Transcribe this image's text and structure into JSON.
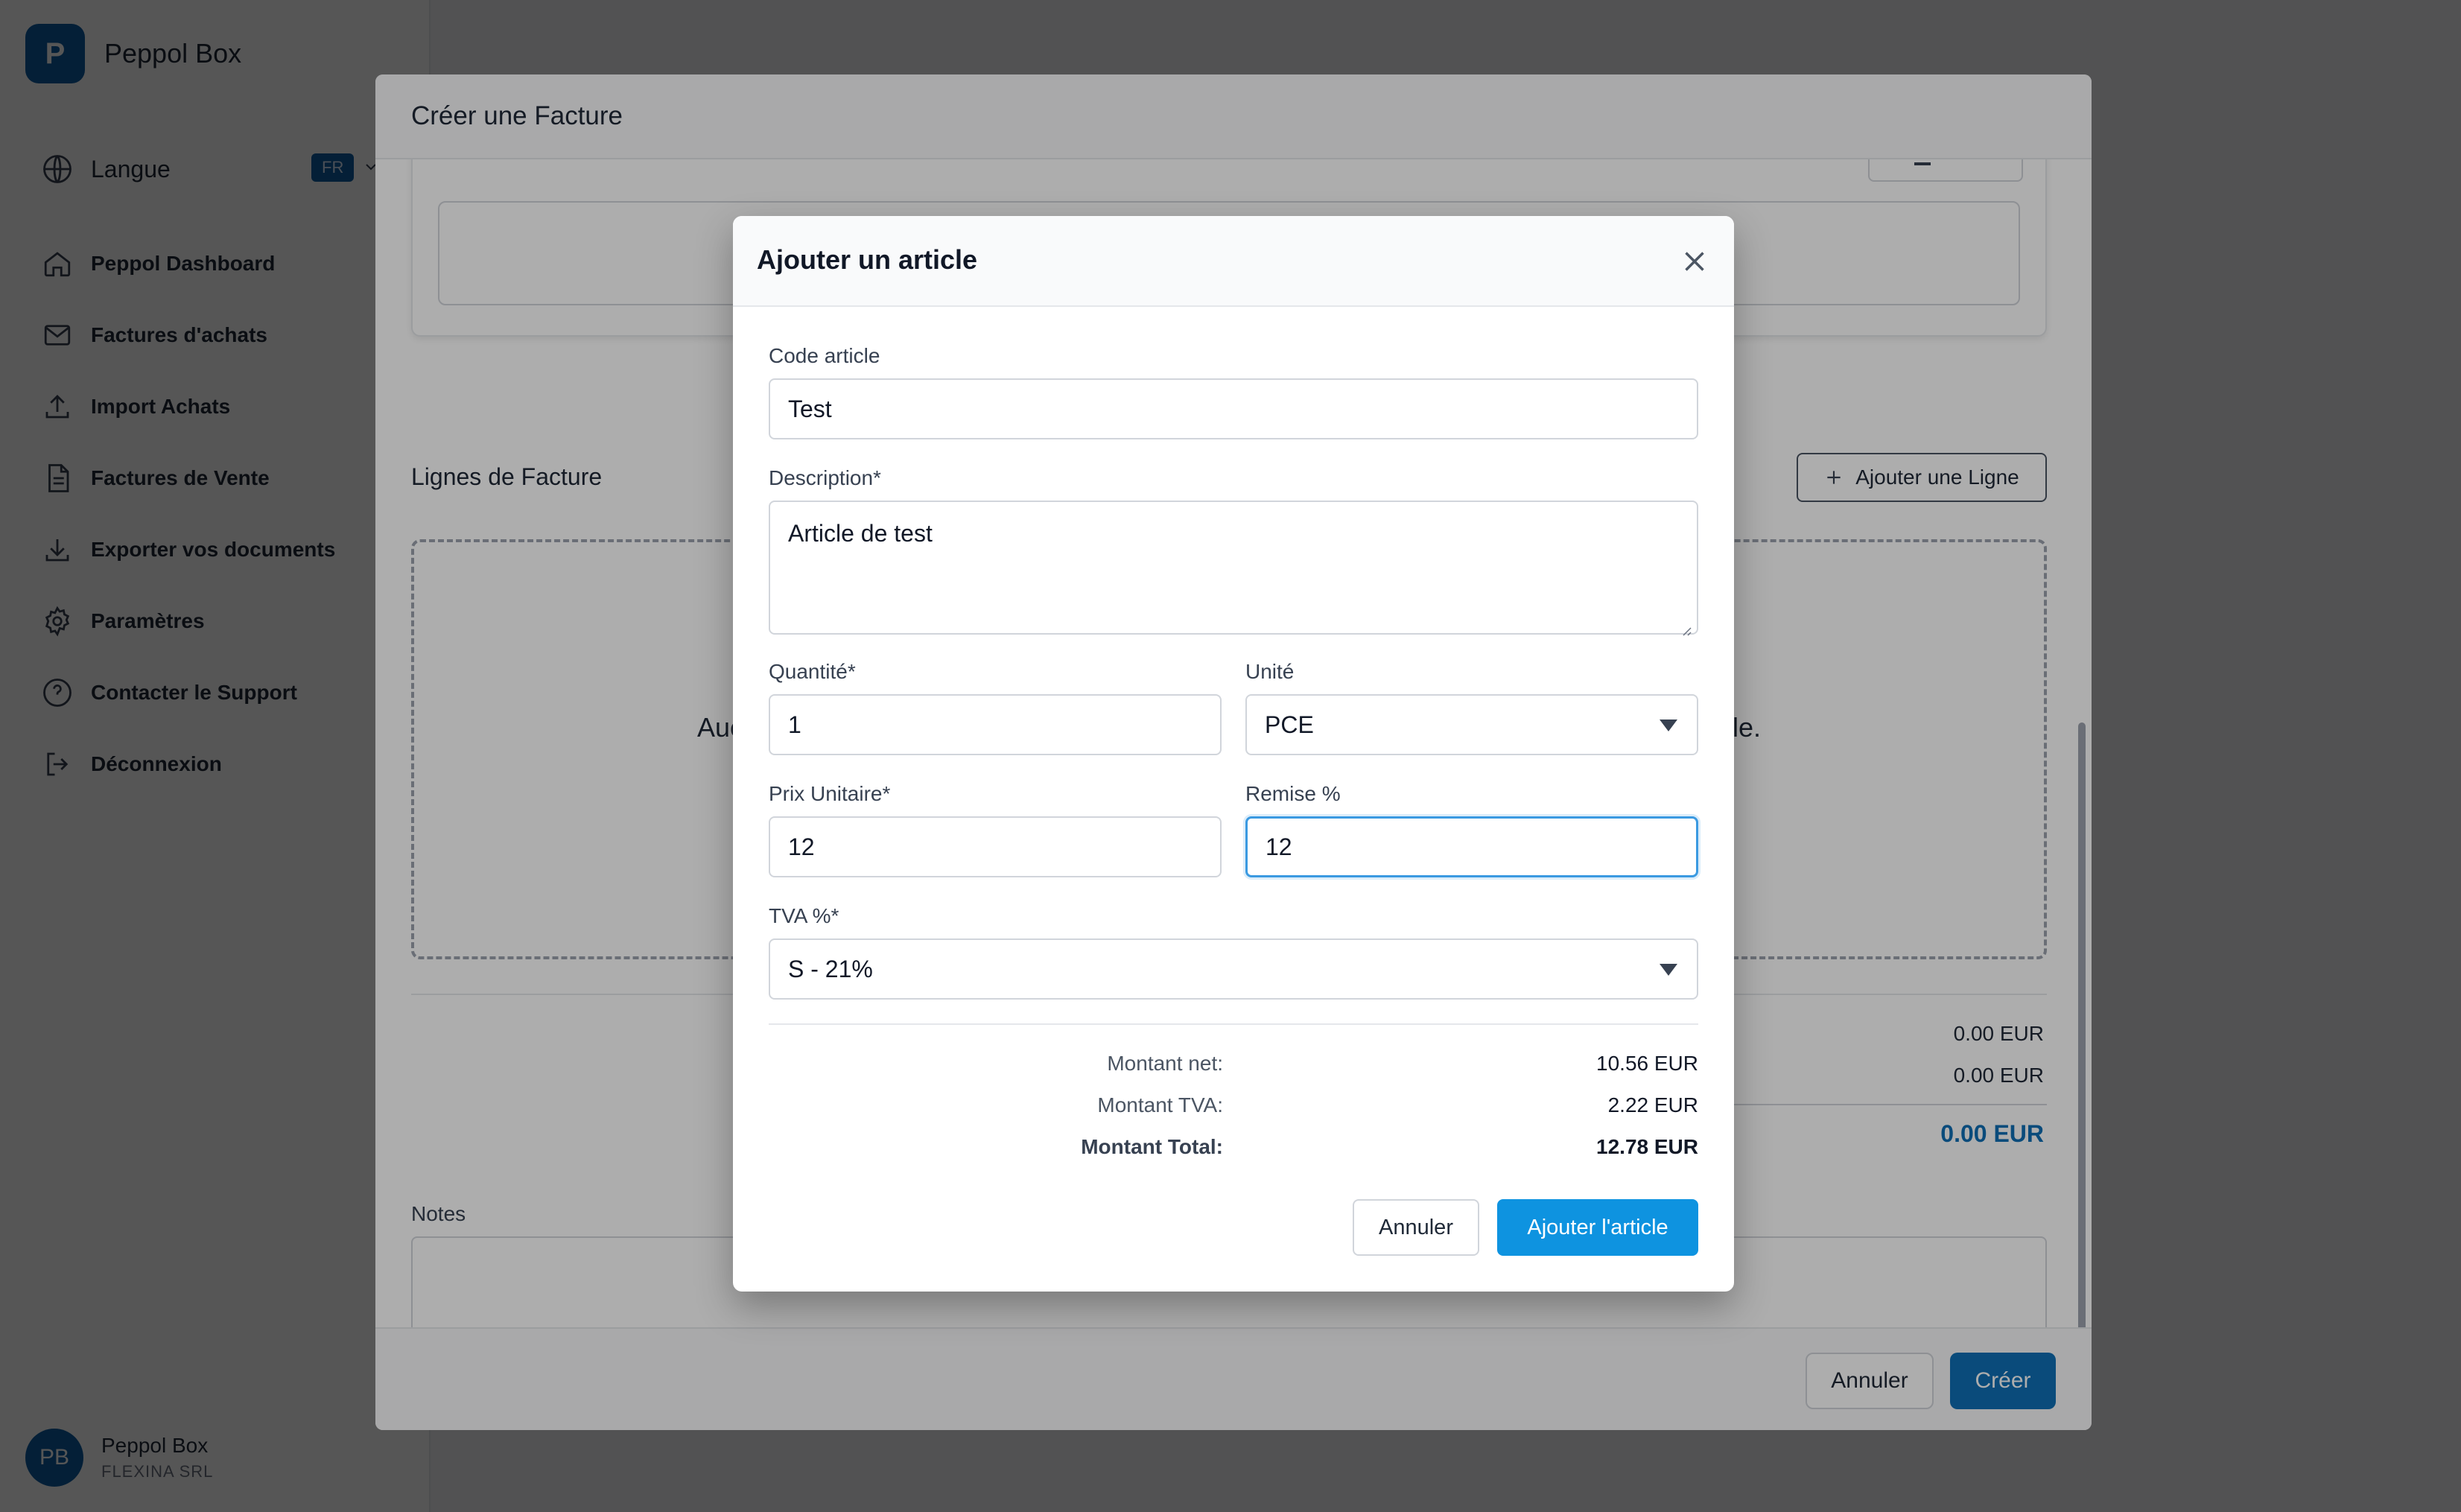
{
  "sidebar": {
    "brand_initial": "P",
    "brand_name": "Peppol Box",
    "language_label": "Langue",
    "language_code": "FR",
    "items": [
      {
        "label": "Peppol Dashboard",
        "icon": "home-icon"
      },
      {
        "label": "Factures d'achats",
        "icon": "mail-icon"
      },
      {
        "label": "Import Achats",
        "icon": "upload-icon"
      },
      {
        "label": "Factures de Vente",
        "icon": "document-icon"
      },
      {
        "label": "Exporter vos documents",
        "icon": "download-icon"
      },
      {
        "label": "Paramètres",
        "icon": "gear-icon"
      },
      {
        "label": "Contacter le Support",
        "icon": "help-icon"
      },
      {
        "label": "Déconnexion",
        "icon": "logout-icon"
      }
    ],
    "user": {
      "initials": "PB",
      "name": "Peppol Box",
      "company": "FLEXINA SRL"
    }
  },
  "invoice_modal": {
    "title": "Créer une Facture",
    "lines_title": "Lignes de Facture",
    "add_line_label": "Ajouter une Ligne",
    "empty_text_left": "Auc",
    "empty_text_right": "le.",
    "totals": {
      "subtotal": "0.00 EUR",
      "vat": "0.00 EUR",
      "total": "0.00 EUR"
    },
    "notes_label": "Notes",
    "cancel_label": "Annuler",
    "create_label": "Créer"
  },
  "article_modal": {
    "title": "Ajouter un article",
    "fields": {
      "code_label": "Code article",
      "code_value": "Test",
      "description_label": "Description*",
      "description_value": "Article de test",
      "quantity_label": "Quantité*",
      "quantity_value": "1",
      "unit_label": "Unité",
      "unit_value": "PCE",
      "price_label": "Prix Unitaire*",
      "price_value": "12",
      "discount_label": "Remise %",
      "discount_value": "12",
      "vat_label": "TVA %*",
      "vat_value": "S - 21%"
    },
    "summary": {
      "net_label": "Montant net:",
      "net_value": "10.56 EUR",
      "vat_label": "Montant TVA:",
      "vat_value": "2.22 EUR",
      "total_label": "Montant Total:",
      "total_value": "12.78 EUR"
    },
    "cancel_label": "Annuler",
    "submit_label": "Ajouter l'article"
  },
  "colors": {
    "brand": "#0f5fa3",
    "primary_button": "#0e93e0",
    "create_button": "#0f6fb5",
    "focus_ring": "#3b9ae1"
  }
}
